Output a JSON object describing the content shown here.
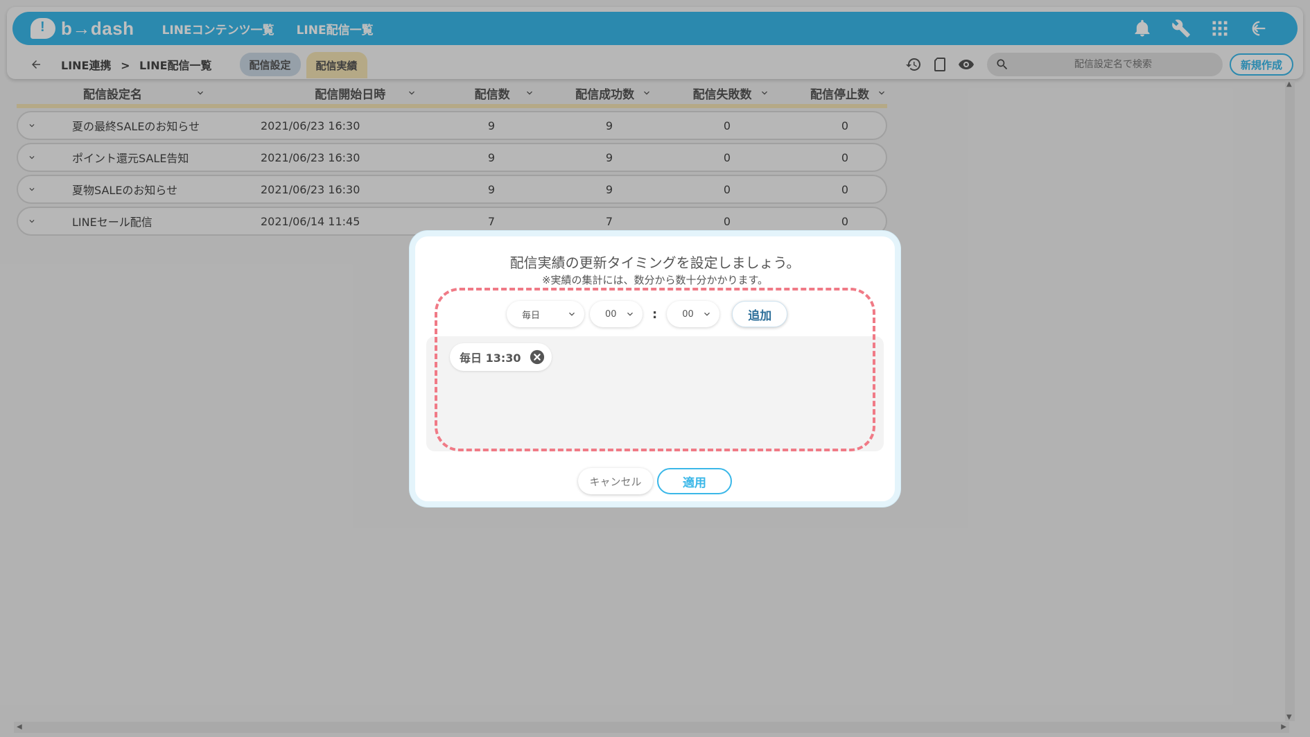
{
  "brand": {
    "logo_text": "b→dash"
  },
  "topnav": {
    "links": [
      "LINEコンテンツ一覧",
      "LINE配信一覧"
    ],
    "icons": [
      "bell-icon",
      "wrench-icon",
      "grid-icon",
      "logout-icon"
    ]
  },
  "subbar": {
    "breadcrumb": [
      "LINE連携",
      ">",
      "LINE配信一覧"
    ],
    "tabs": [
      "配信設定",
      "配信実績"
    ],
    "icons": [
      "history-icon",
      "document-icon",
      "eye-icon"
    ],
    "search_placeholder": "配信設定名で検索",
    "create_label": "新規作成"
  },
  "table": {
    "columns": [
      "配信設定名",
      "配信開始日時",
      "配信数",
      "配信成功数",
      "配信失敗数",
      "配信停止数"
    ],
    "rows": [
      {
        "name": "夏の最終SALEのお知らせ",
        "date": "2021/06/23 16:30",
        "count": "9",
        "success": "9",
        "fail": "0",
        "stop": "0"
      },
      {
        "name": "ポイント還元SALE告知",
        "date": "2021/06/23 16:30",
        "count": "9",
        "success": "9",
        "fail": "0",
        "stop": "0"
      },
      {
        "name": "夏物SALEのお知らせ",
        "date": "2021/06/23 16:30",
        "count": "9",
        "success": "9",
        "fail": "0",
        "stop": "0"
      },
      {
        "name": "LINEセール配信",
        "date": "2021/06/14 11:45",
        "count": "7",
        "success": "7",
        "fail": "0",
        "stop": "0"
      }
    ]
  },
  "modal": {
    "title": "配信実績の更新タイミングを設定しましょう。",
    "subtitle": "※実績の集計には、数分から数十分かかります。",
    "frequency": "毎日",
    "hour": "00",
    "colon": ":",
    "minute": "00",
    "add_label": "追加",
    "chips": [
      "毎日 13:30"
    ],
    "cancel_label": "キャンセル",
    "apply_label": "適用"
  },
  "colors": {
    "accent": "#3ab7e8",
    "highlight_dash": "#f07a86",
    "tab_active": "#f2e2b3"
  }
}
